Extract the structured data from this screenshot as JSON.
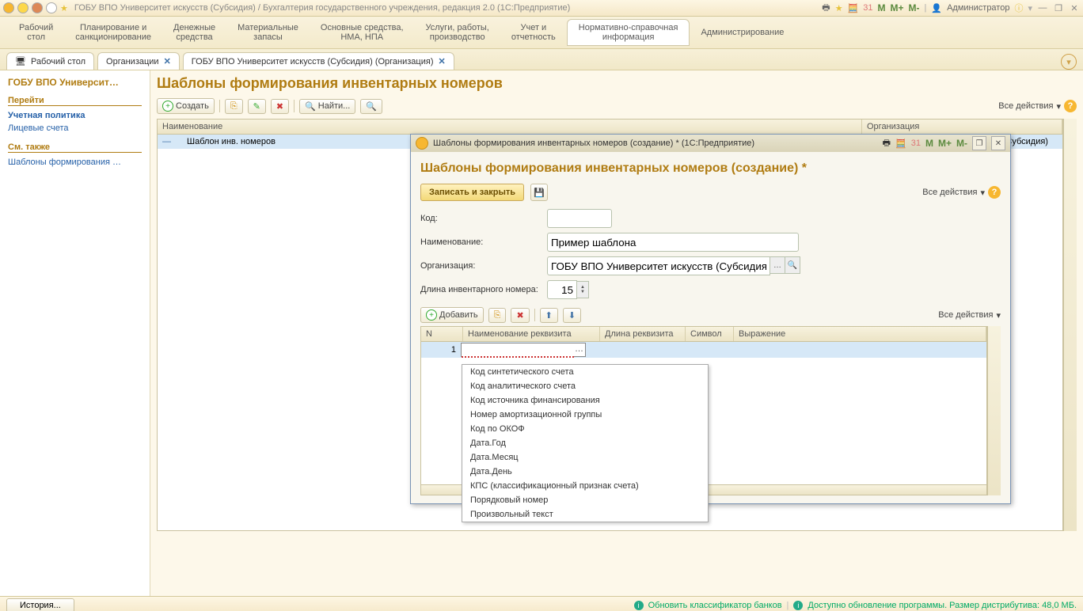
{
  "titlebar": {
    "text": "ГОБУ ВПО Университет искусств (Субсидия) / Бухгалтерия государственного учреждения, редакция 2.0  (1С:Предприятие)",
    "user_label": "Администратор"
  },
  "menubar": {
    "items": [
      "Рабочий\nстол",
      "Планирование и\nсанкционирование",
      "Денежные\nсредства",
      "Материальные\nзапасы",
      "Основные средства,\nНМА, НПА",
      "Услуги, работы,\nпроизводство",
      "Учет и\nотчетность",
      "Нормативно-справочная\nинформация",
      "Администрирование"
    ],
    "active_index": 7
  },
  "tabs": [
    {
      "label": "Рабочий стол",
      "icon": "desktop"
    },
    {
      "label": "Организации"
    },
    {
      "label": "ГОБУ ВПО Университет искусств (Субсидия) (Организация)"
    }
  ],
  "sidebar": {
    "title": "ГОБУ ВПО Университ…",
    "sections": [
      {
        "head": "Перейти",
        "links": [
          {
            "label": "Учетная политика",
            "bold": true
          },
          {
            "label": "Лицевые счета"
          }
        ]
      },
      {
        "head": "См. также",
        "links": [
          {
            "label": "Шаблоны формирования …"
          }
        ]
      }
    ]
  },
  "main": {
    "title": "Шаблоны формирования инвентарных номеров",
    "toolbar": {
      "create": "Создать",
      "find": "Найти...",
      "all_actions": "Все действия"
    },
    "grid": {
      "cols": [
        "Наименование",
        "Организация"
      ],
      "row": {
        "name": "Шаблон инв. номеров",
        "org": "ГОБУ ВПО Университет искусств (Субсидия)"
      }
    }
  },
  "dialog": {
    "wintitle": "Шаблоны формирования инвентарных номеров (создание) *  (1С:Предприятие)",
    "title": "Шаблоны формирования инвентарных номеров (создание) *",
    "btn_save": "Записать и закрыть",
    "all_actions": "Все действия",
    "fields": {
      "code_label": "Код:",
      "code_value": "",
      "name_label": "Наименование:",
      "name_value": "Пример шаблона",
      "org_label": "Организация:",
      "org_value": "ГОБУ ВПО Университет искусств (Субсидия)",
      "len_label": "Длина инвентарного номера:",
      "len_value": "15"
    },
    "tb2": {
      "add": "Добавить",
      "all_actions": "Все действия"
    },
    "grid": {
      "cols": [
        "N",
        "Наименование реквизита",
        "Длина реквизита",
        "Символ",
        "Выражение"
      ],
      "row_n": "1"
    },
    "dropdown": [
      "Код синтетического счета",
      "Код аналитического счета",
      "Код источника финансирования",
      "Номер амортизационной группы",
      "Код по ОКОФ",
      "Дата.Год",
      "Дата.Месяц",
      "Дата.День",
      "КПС (классификационный признак счета)",
      "Порядковый номер",
      "Произвольный текст"
    ]
  },
  "statusbar": {
    "history": "История...",
    "msg1": "Обновить классификатор банков",
    "msg2": "Доступно обновление программы. Размер дистрибутива: 48,0 МБ."
  }
}
